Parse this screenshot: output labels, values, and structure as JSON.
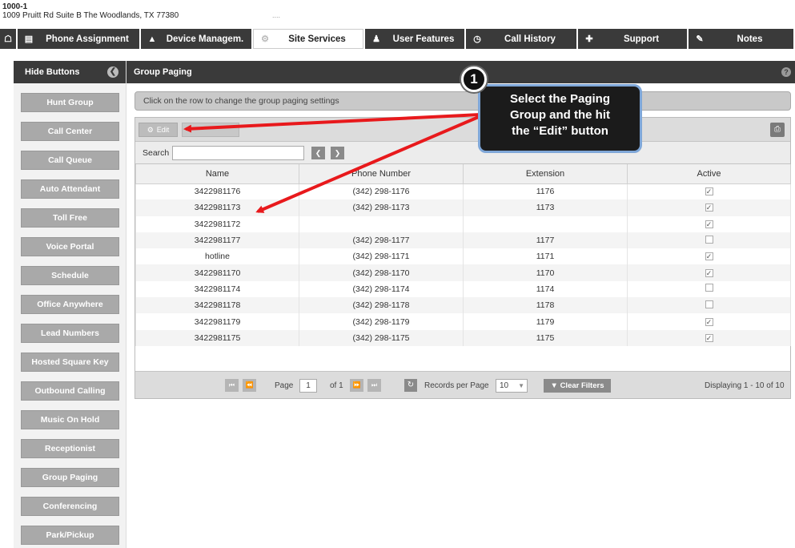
{
  "site": {
    "account": "1000-1",
    "address": "1009 Pruitt Rd Suite B The Woodlands, TX 77380",
    "dots": "...."
  },
  "nav": {
    "tabs": [
      {
        "label": "",
        "icon": "home-icon"
      },
      {
        "label": "Phone Assignment",
        "icon": "list-icon"
      },
      {
        "label": "Device Managem.",
        "icon": "bell-icon"
      },
      {
        "label": "Site Services",
        "icon": "gear-icon"
      },
      {
        "label": "User Features",
        "icon": "user-icon"
      },
      {
        "label": "Call History",
        "icon": "clock-icon"
      },
      {
        "label": "Support",
        "icon": "wrench-icon"
      },
      {
        "label": "Notes",
        "icon": "pencil-icon"
      }
    ],
    "active": "Site Services"
  },
  "sidebar": {
    "header": "Hide Buttons",
    "items": [
      "Hunt Group",
      "Call Center",
      "Call Queue",
      "Auto Attendant",
      "Toll Free",
      "Voice Portal",
      "Schedule",
      "Office Anywhere",
      "Lead Numbers",
      "Hosted Square Key",
      "Outbound Calling",
      "Music On Hold",
      "Receptionist",
      "Group Paging",
      "Conferencing",
      "Park/Pickup"
    ]
  },
  "panel": {
    "title": "Group Paging",
    "info": "Click on the row to change the group paging settings"
  },
  "toolbar": {
    "edit_label": "Edit",
    "add_label": ""
  },
  "search": {
    "label": "Search",
    "value": ""
  },
  "table": {
    "columns": [
      "Name",
      "Phone Number",
      "Extension",
      "Active"
    ],
    "rows": [
      {
        "name": "3422981176",
        "phone": "(342) 298-1176",
        "ext": "1176",
        "active": true
      },
      {
        "name": "3422981173",
        "phone": "(342) 298-1173",
        "ext": "1173",
        "active": true
      },
      {
        "name": "3422981172",
        "phone": "",
        "ext": "",
        "active": true
      },
      {
        "name": "3422981177",
        "phone": "(342) 298-1177",
        "ext": "1177",
        "active": false
      },
      {
        "name": "hotline",
        "phone": "(342) 298-1171",
        "ext": "1171",
        "active": true
      },
      {
        "name": "3422981170",
        "phone": "(342) 298-1170",
        "ext": "1170",
        "active": true
      },
      {
        "name": "3422981174",
        "phone": "(342) 298-1174",
        "ext": "1174",
        "active": false
      },
      {
        "name": "3422981178",
        "phone": "(342) 298-1178",
        "ext": "1178",
        "active": false
      },
      {
        "name": "3422981179",
        "phone": "(342) 298-1179",
        "ext": "1179",
        "active": true
      },
      {
        "name": "3422981175",
        "phone": "(342) 298-1175",
        "ext": "1175",
        "active": true
      }
    ]
  },
  "pager": {
    "page_label": "Page",
    "page": "1",
    "of_label": "of 1",
    "rpp_label": "Records per Page",
    "rpp": "10",
    "clear_label": "Clear Filters",
    "displaying": "Displaying 1 - 10 of 10"
  },
  "callout": {
    "step": "1",
    "lines": [
      "Select the Paging",
      "Group and the hit",
      "the “Edit” button"
    ]
  },
  "colors": {
    "dark": "#3a3a3a",
    "button_gray": "#a9a9a9",
    "arrow_red": "#e8191c",
    "callout_border": "#7fa7d8"
  }
}
